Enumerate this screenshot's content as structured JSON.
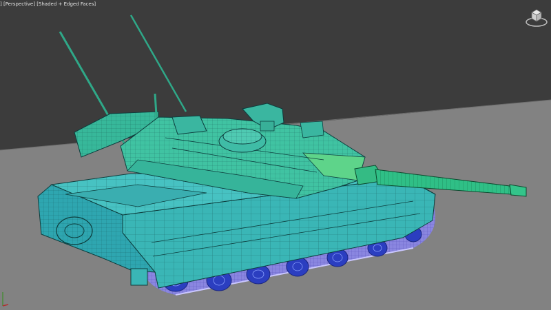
{
  "viewport": {
    "label_parts": [
      "] [",
      "Perspective",
      "] [",
      "Shaded + Edged Faces",
      "]"
    ],
    "background_color": "#3c3c3c",
    "ground_color": "#828282"
  },
  "model": {
    "hull_color": "#3ab6b6",
    "turret_color": "#40c3a2",
    "barrel_color": "#2fbf86",
    "track_color": "#8a86e0",
    "edge_color": "#0d3d3d"
  },
  "icons": {
    "viewcube": "viewcube-icon",
    "axis": "axis-tripod-icon"
  }
}
